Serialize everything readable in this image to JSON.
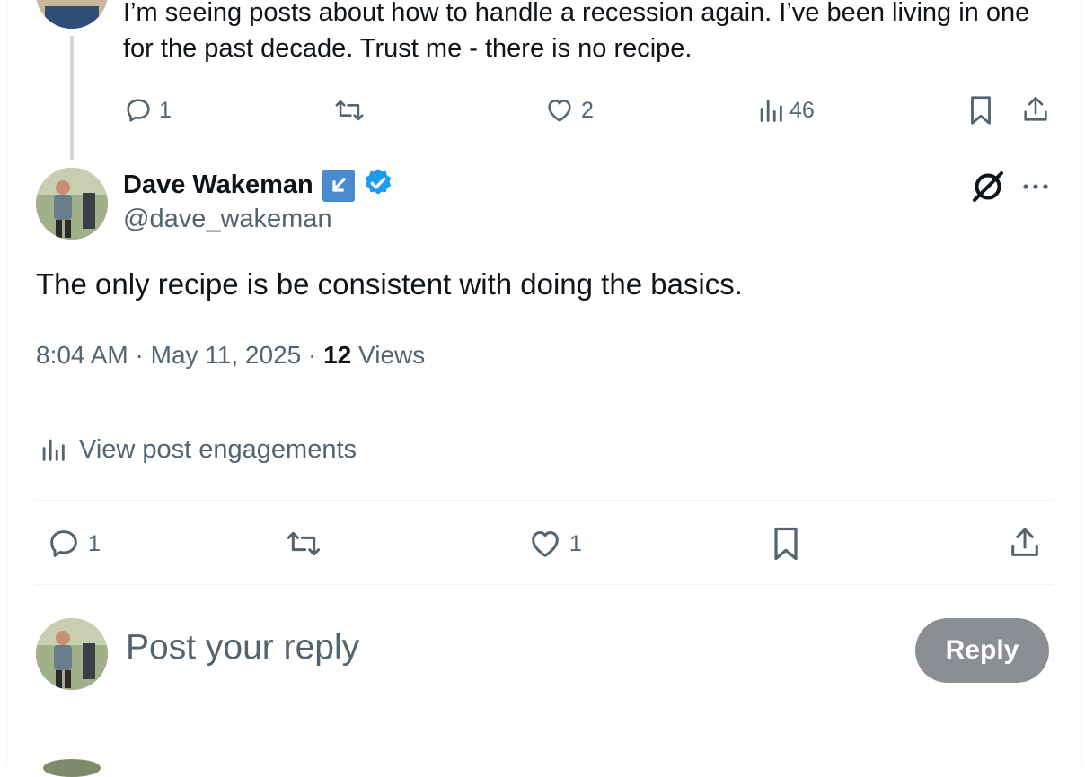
{
  "previous_post": {
    "text": "I’m seeing posts about how to handle a recession again. I’ve been living in one for the past decade. Trust me - there is no recipe.",
    "actions": {
      "replies": "1",
      "likes": "2",
      "views": "46"
    }
  },
  "post": {
    "author": {
      "display_name": "Dave Wakeman",
      "handle": "@dave_wakeman"
    },
    "text": "The only recipe is be consistent with doing the basics.",
    "meta": {
      "time": "8:04 AM",
      "separator": "·",
      "date": "May 11, 2025",
      "views_count": "12",
      "views_label": "Views"
    },
    "engagements_label": "View post engagements",
    "actions": {
      "replies": "1",
      "likes": "1"
    }
  },
  "composer": {
    "placeholder": "Post your reply",
    "reply_button": "Reply"
  },
  "colors": {
    "text_primary": "#0f1419",
    "text_secondary": "#536471",
    "verified_blue": "#1d9bf0",
    "affiliate_badge": "#4a8bd0",
    "reply_button_disabled": "#8b8f93"
  },
  "icons": [
    "reply-icon",
    "repost-icon",
    "like-icon",
    "views-icon",
    "bookmark-icon",
    "share-icon",
    "affiliate-badge-icon",
    "verified-badge-icon",
    "grok-icon",
    "more-icon",
    "analytics-icon"
  ]
}
